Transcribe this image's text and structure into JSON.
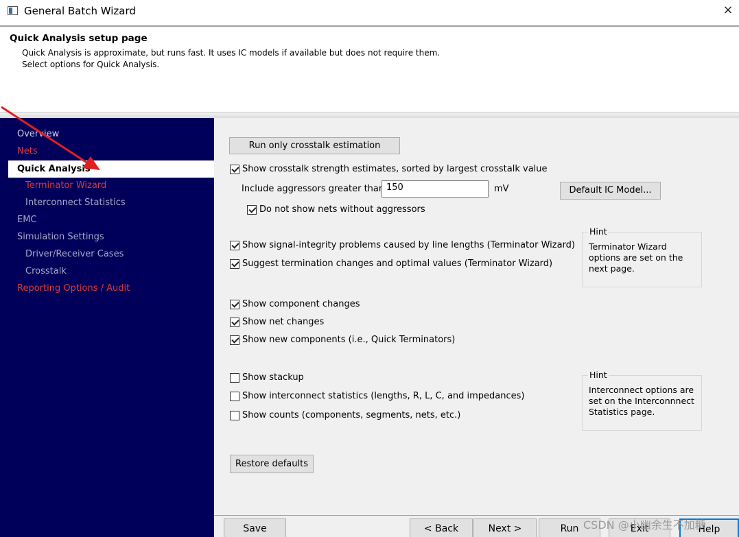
{
  "window": {
    "title": "General Batch Wizard",
    "close_glyph": "×"
  },
  "header": {
    "title": "Quick Analysis setup page",
    "line1": "Quick Analysis is approximate, but runs fast. It uses IC models if available but does not require them.",
    "line2": "Select options for Quick Analysis."
  },
  "sidebar": {
    "items": [
      {
        "label": "Overview",
        "style": "white"
      },
      {
        "label": "Nets",
        "style": "red"
      },
      {
        "label": "Quick Analysis",
        "style": "active"
      },
      {
        "label": "Terminator Wizard",
        "style": "red-sub"
      },
      {
        "label": "Interconnect Statistics",
        "style": "gray-sub"
      },
      {
        "label": "EMC",
        "style": "gray"
      },
      {
        "label": "Simulation Settings",
        "style": "gray"
      },
      {
        "label": "Driver/Receiver Cases",
        "style": "gray-sub"
      },
      {
        "label": "Crosstalk",
        "style": "gray-sub"
      },
      {
        "label": "Reporting Options / Audit",
        "style": "red"
      }
    ]
  },
  "main": {
    "run_crosstalk_button": "Run only crosstalk estimation",
    "show_crosstalk": {
      "label": "Show crosstalk strength estimates, sorted by largest crosstalk value",
      "checked": true
    },
    "aggressors_label": "Include aggressors greater than:",
    "aggressors_value": "150",
    "aggressors_unit": "mV",
    "default_ic_button": "Default IC Model...",
    "no_aggressor_nets": {
      "label": "Do not show nets without aggressors",
      "checked": true
    },
    "si_problems": {
      "label": "Show signal-integrity problems caused by line lengths (Terminator Wizard)",
      "checked": true
    },
    "suggest_termination": {
      "label": "Suggest termination changes and optimal values (Terminator Wizard)",
      "checked": true
    },
    "hint1": {
      "title": "Hint",
      "lines": [
        "Terminator Wizard",
        "options are set on the",
        "next page."
      ]
    },
    "component_changes": {
      "label": "Show component changes",
      "checked": true
    },
    "net_changes": {
      "label": "Show net changes",
      "checked": true
    },
    "new_components": {
      "label": "Show new components  (i.e., Quick Terminators)",
      "checked": true
    },
    "stackup": {
      "label": "Show stackup",
      "checked": false
    },
    "interconnect_stats": {
      "label": "Show interconnect statistics (lengths, R, L, C, and impedances)",
      "checked": false
    },
    "counts": {
      "label": "Show counts (components, segments, nets, etc.)",
      "checked": false
    },
    "hint2": {
      "title": "Hint",
      "lines": [
        "Interconnect options are",
        "set on the Interconnnect",
        "Statistics page."
      ]
    },
    "restore_button": "Restore defaults"
  },
  "footer": {
    "save": "Save",
    "back": "< Back",
    "next": "Next >",
    "run": "Run",
    "exit": "Exit",
    "help": "Help"
  },
  "watermark": "CSDN @小幽余生不加糖",
  "colors": {
    "sidebar_bg": "#00005a",
    "nav_red": "#d83a3a",
    "annotation_arrow": "#e02020"
  }
}
